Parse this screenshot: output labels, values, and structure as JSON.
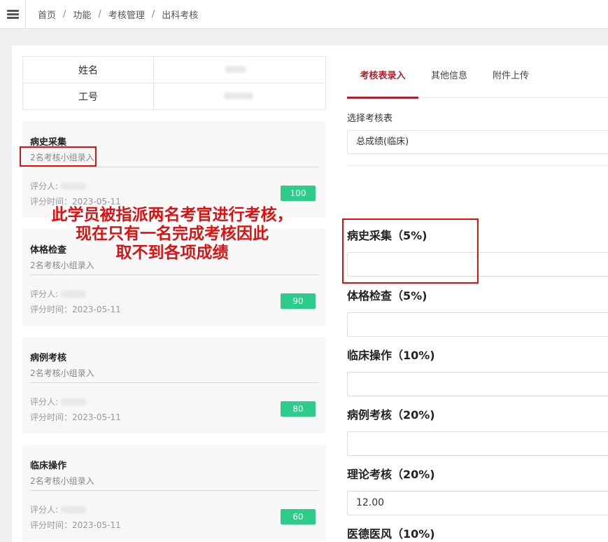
{
  "breadcrumb": [
    "首页",
    "功能",
    "考核管理",
    "出科考核"
  ],
  "info": {
    "name_label": "姓名",
    "id_label": "工号"
  },
  "cards": [
    {
      "title": "病史采集",
      "sub": "2名考核小组录入",
      "rater_label": "评分人:",
      "time": "评分时间：2023-05-11",
      "score": "100"
    },
    {
      "title": "体格检查",
      "sub": "2名考核小组录入",
      "rater_label": "评分人:",
      "time": "评分时间：2023-05-11",
      "score": "90"
    },
    {
      "title": "病例考核",
      "sub": "2名考核小组录入",
      "rater_label": "评分人:",
      "time": "评分时间：2023-05-11",
      "score": "80"
    },
    {
      "title": "临床操作",
      "sub": "2名考核小组录入",
      "rater_label": "评分人:",
      "time": "评分时间：2023-05-11",
      "score": "60"
    }
  ],
  "annotation": [
    "此学员被指派两名考官进行考核，",
    "现在只有一名完成考核因此",
    "取不到各项成绩"
  ],
  "tabs": [
    "考核表录入",
    "其他信息",
    "附件上传"
  ],
  "form": {
    "select_label": "选择考核表",
    "select_value": "总成绩(临床)",
    "fields": [
      {
        "label": "病史采集（5%)",
        "value": ""
      },
      {
        "label": "体格检查（5%)",
        "value": ""
      },
      {
        "label": "临床操作（10%)",
        "value": ""
      },
      {
        "label": "病例考核（20%)",
        "value": ""
      },
      {
        "label": "理论考核（20%)",
        "value": "12.00"
      },
      {
        "label": "医德医风（10%)",
        "value": ""
      }
    ]
  },
  "colors": {
    "accent": "#a8232c",
    "score_badge": "#2ecc8a",
    "annotation": "#e01010"
  }
}
